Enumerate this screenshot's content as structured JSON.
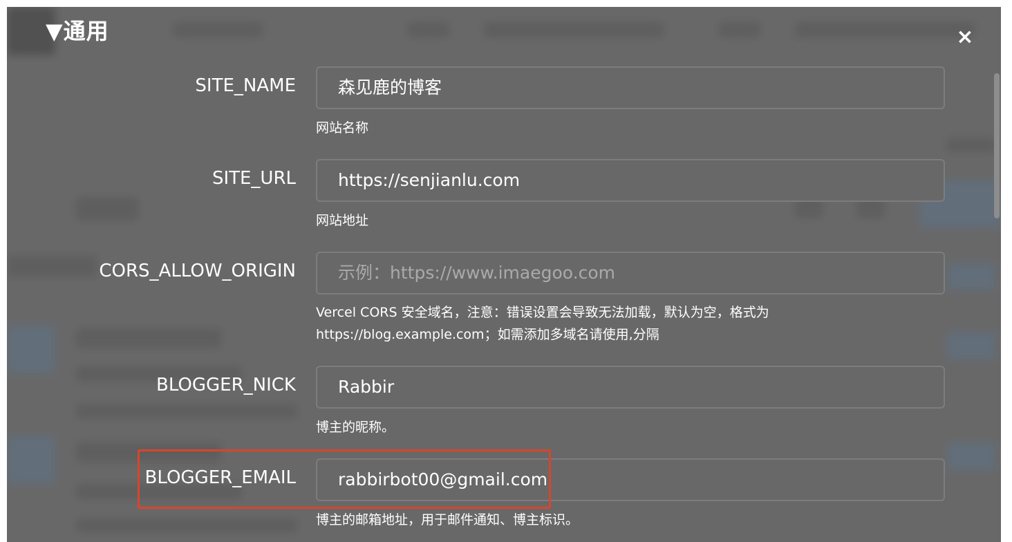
{
  "section": {
    "arrow": "▼",
    "title": "通用",
    "close_icon": "×"
  },
  "fields": [
    {
      "key": "SITE_NAME",
      "value": "森见鹿的博客",
      "placeholder": "",
      "hint_lines": [
        "网站名称"
      ]
    },
    {
      "key": "SITE_URL",
      "value": "https://senjianlu.com",
      "placeholder": "",
      "hint_lines": [
        "网站地址"
      ]
    },
    {
      "key": "CORS_ALLOW_ORIGIN",
      "value": "",
      "placeholder": "示例：https://www.imaegoo.com",
      "hint_lines": [
        "Vercel CORS 安全域名，注意：错误设置会导致无法加载，默认为空，格式为",
        "https://blog.example.com；如需添加多域名请使用,分隔"
      ]
    },
    {
      "key": "BLOGGER_NICK",
      "value": "Rabbir",
      "placeholder": "",
      "hint_lines": [
        "博主的昵称。"
      ]
    },
    {
      "key": "BLOGGER_EMAIL",
      "value": "rabbirbot00@gmail.com",
      "placeholder": "",
      "hint_lines": [
        "博主的邮箱地址，用于邮件通知、博主标识。"
      ]
    }
  ],
  "colors": {
    "highlight": "#d9452b",
    "overlay": "#6b6b6b"
  }
}
